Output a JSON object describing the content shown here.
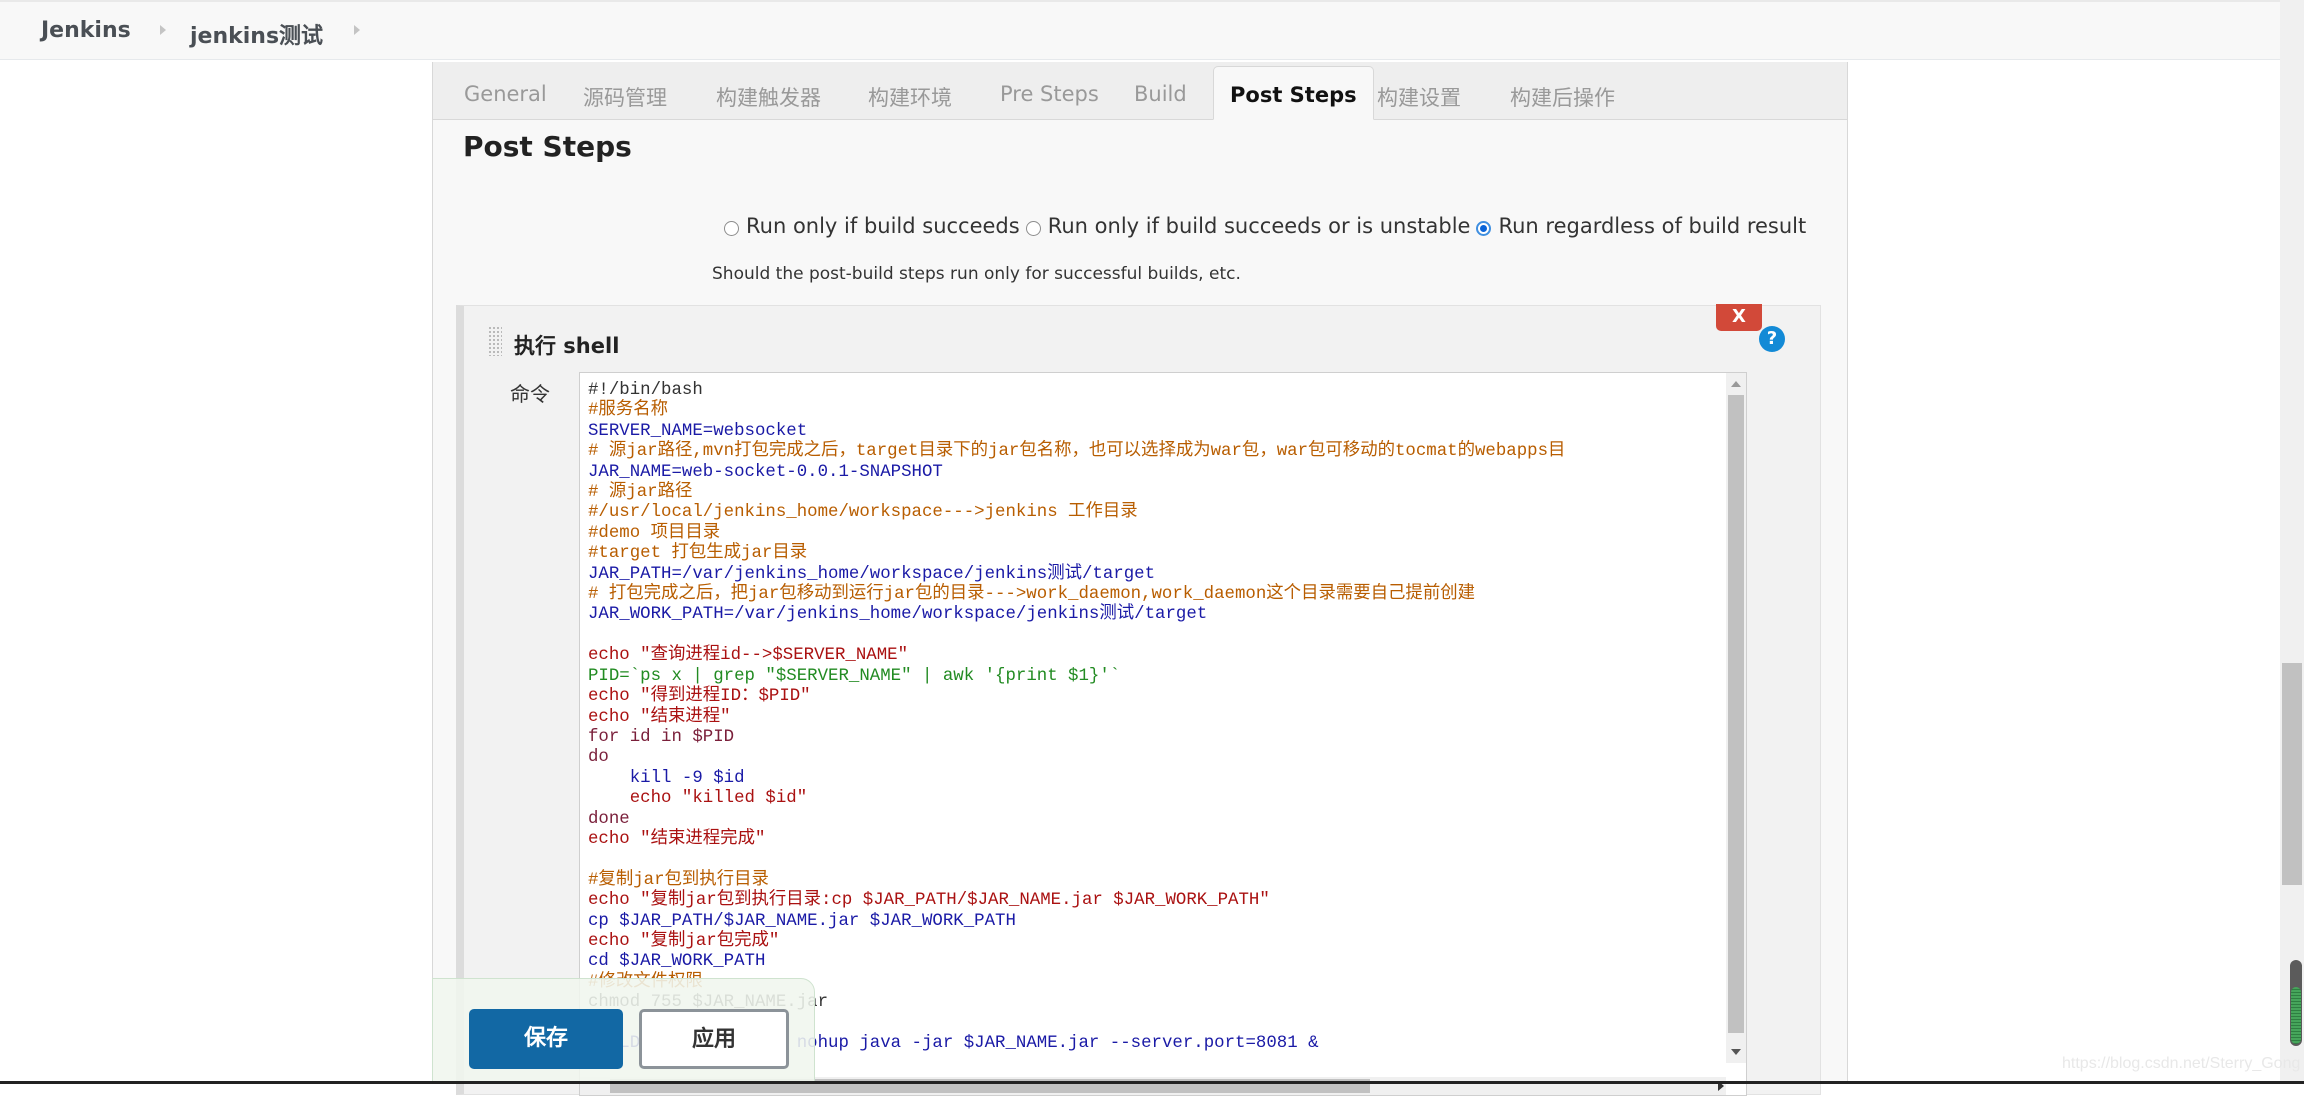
{
  "breadcrumb": {
    "items": [
      "Jenkins",
      "jenkins测试"
    ]
  },
  "tabs": [
    {
      "label": "General",
      "active": false
    },
    {
      "label": "源码管理",
      "active": false
    },
    {
      "label": "构建触发器",
      "active": false
    },
    {
      "label": "构建环境",
      "active": false
    },
    {
      "label": "Pre Steps",
      "active": false
    },
    {
      "label": "Build",
      "active": false
    },
    {
      "label": "Post Steps",
      "active": true
    },
    {
      "label": "构建设置",
      "active": false
    },
    {
      "label": "构建后操作",
      "active": false
    }
  ],
  "section": {
    "title": "Post Steps",
    "radio_options": [
      {
        "label": "Run only if build succeeds",
        "checked": false
      },
      {
        "label": "Run only if build succeeds or is unstable",
        "checked": false
      },
      {
        "label": "Run regardless of build result",
        "checked": true
      }
    ],
    "help_text": "Should the post-build steps run only for successful builds, etc."
  },
  "shell_step": {
    "title": "执行 shell",
    "delete_label": "X",
    "help_label": "?",
    "command_label": "命令",
    "command_lines": [
      {
        "t": "#!/bin/bash",
        "c": "c-plain"
      },
      {
        "t": "#服务名称",
        "c": "c-comment"
      },
      {
        "t": "SERVER_NAME=websocket",
        "c": "c-var"
      },
      {
        "t": "# 源jar路径,mvn打包完成之后，target目录下的jar包名称，也可以选择成为war包，war包可移动的tocmat的webapps目",
        "c": "c-comment"
      },
      {
        "t": "JAR_NAME=web-socket-0.0.1-SNAPSHOT",
        "c": "c-var"
      },
      {
        "t": "# 源jar路径",
        "c": "c-comment"
      },
      {
        "t": "#/usr/local/jenkins_home/workspace--->jenkins 工作目录",
        "c": "c-comment"
      },
      {
        "t": "#demo 项目目录",
        "c": "c-comment"
      },
      {
        "t": "#target 打包生成jar目录",
        "c": "c-comment"
      },
      {
        "t": "JAR_PATH=/var/jenkins_home/workspace/jenkins测试/target",
        "c": "c-var"
      },
      {
        "t": "# 打包完成之后，把jar包移动到运行jar包的目录--->work_daemon,work_daemon这个目录需要自己提前创建",
        "c": "c-comment"
      },
      {
        "t": "JAR_WORK_PATH=/var/jenkins_home/workspace/jenkins测试/target",
        "c": "c-var"
      },
      {
        "t": "",
        "c": "c-plain"
      },
      {
        "t": "echo \"查询进程id-->$SERVER_NAME\"",
        "c": "c-str"
      },
      {
        "t": "PID=`ps x | grep \"$SERVER_NAME\" | awk '{print $1}'`",
        "c": "c-cmd"
      },
      {
        "t": "echo \"得到进程ID：$PID\"",
        "c": "c-str"
      },
      {
        "t": "echo \"结束进程\"",
        "c": "c-str"
      },
      {
        "t": "for id in $PID",
        "c": "c-kw"
      },
      {
        "t": "do",
        "c": "c-kw"
      },
      {
        "t": "    kill -9 $id",
        "c": "c-var"
      },
      {
        "t": "    echo \"killed $id\"",
        "c": "c-str"
      },
      {
        "t": "done",
        "c": "c-kw"
      },
      {
        "t": "echo \"结束进程完成\"",
        "c": "c-str"
      },
      {
        "t": "",
        "c": "c-plain"
      },
      {
        "t": "#复制jar包到执行目录",
        "c": "c-comment"
      },
      {
        "t": "echo \"复制jar包到执行目录:cp $JAR_PATH/$JAR_NAME.jar $JAR_WORK_PATH\"",
        "c": "c-str"
      },
      {
        "t": "cp $JAR_PATH/$JAR_NAME.jar $JAR_WORK_PATH",
        "c": "c-var"
      },
      {
        "t": "echo \"复制jar包完成\"",
        "c": "c-str"
      },
      {
        "t": "cd $JAR_WORK_PATH",
        "c": "c-var"
      },
      {
        "t": "#修改文件权限",
        "c": "c-comment"
      },
      {
        "t": "chmod 755 $JAR_NAME.jar",
        "c": "c-plain"
      },
      {
        "t": "",
        "c": "c-plain"
      },
      {
        "t": "BUILD_ID=dontKillMe nohup java -jar $JAR_NAME.jar --server.port=8081 &",
        "c": "c-var"
      }
    ]
  },
  "actions": {
    "save_label": "保存",
    "apply_label": "应用"
  },
  "watermark": "https://blog.csdn.net/Sterry_Gong",
  "colors": {
    "save_button": "#1268a4",
    "delete_button": "#d24939",
    "help_icon": "#138ad6",
    "active_tab_text": "#111111"
  }
}
